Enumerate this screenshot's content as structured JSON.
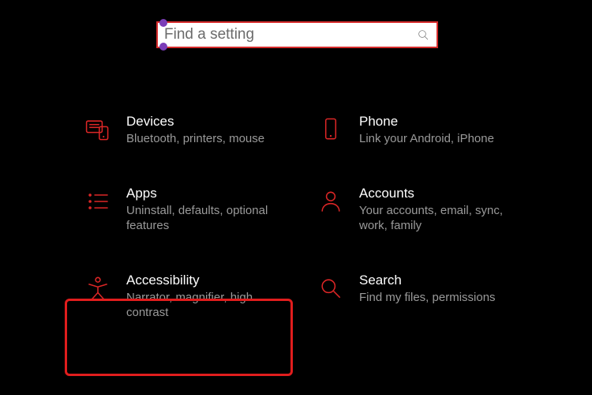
{
  "search": {
    "placeholder": "Find a setting",
    "value": ""
  },
  "items": [
    {
      "id": "devices",
      "title": "Devices",
      "desc": "Bluetooth, printers, mouse"
    },
    {
      "id": "phone",
      "title": "Phone",
      "desc": "Link your Android, iPhone"
    },
    {
      "id": "apps",
      "title": "Apps",
      "desc": "Uninstall, defaults, optional features"
    },
    {
      "id": "accounts",
      "title": "Accounts",
      "desc": "Your accounts, email, sync, work, family"
    },
    {
      "id": "accessibility",
      "title": "Accessibility",
      "desc": "Narrator, magnifier, high contrast"
    },
    {
      "id": "search",
      "title": "Search",
      "desc": "Find my files, permissions"
    }
  ],
  "highlighted_item": "accessibility",
  "colors": {
    "accent": "#dc2626",
    "bg": "#000000"
  }
}
